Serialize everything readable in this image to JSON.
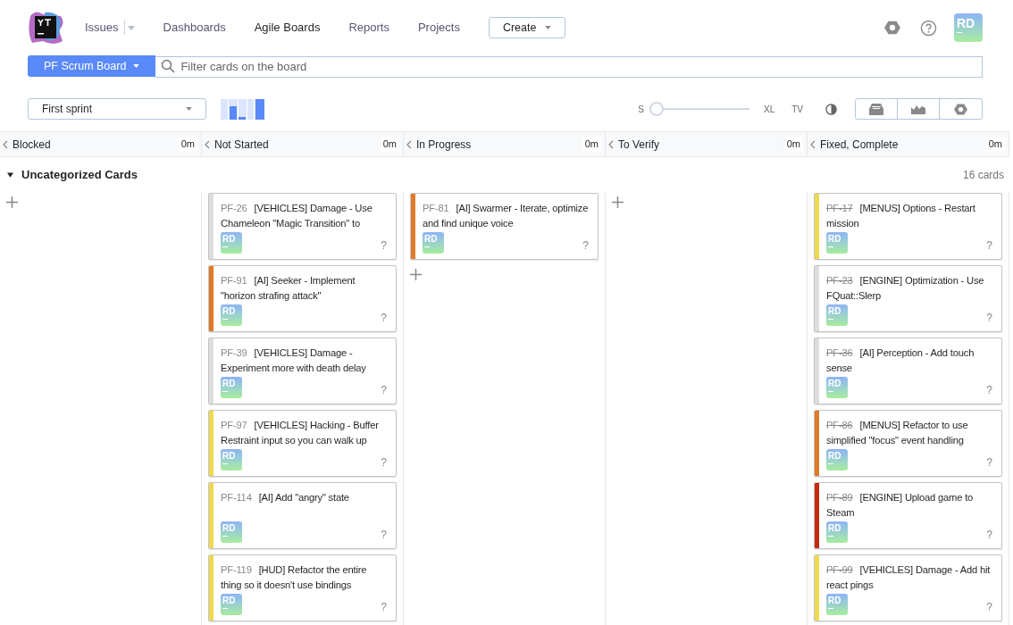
{
  "nav": [
    {
      "label": "Issues",
      "selected": false,
      "dropdown": true
    },
    {
      "label": "Dashboards",
      "selected": false,
      "dropdown": false
    },
    {
      "label": "Agile Boards",
      "selected": true,
      "dropdown": false
    },
    {
      "label": "Reports",
      "selected": false,
      "dropdown": false
    },
    {
      "label": "Projects",
      "selected": false,
      "dropdown": false
    }
  ],
  "create_button": "Create",
  "user": "RD",
  "board_button": "PF Scrum Board",
  "search": {
    "placeholder": "Filter cards on the board"
  },
  "sprint": "First sprint",
  "size": {
    "min": "S",
    "max": "XL",
    "tv": "TV",
    "level": 0
  },
  "columns": [
    {
      "name": "Blocked",
      "time": "0m"
    },
    {
      "name": "Not Started",
      "time": "0m",
      "cards": [
        {
          "id": "PF-26",
          "title": "[VEHICLES] Damage - Use Chameleon \"Magic Transition\" to",
          "color": "#dddddd",
          "resolved": false,
          "assignee": "RD",
          "estimate": "?"
        },
        {
          "id": "PF-91",
          "title": "[AI] Seeker - Implement \"horizon strafing attack\"",
          "color": "#e07b2a",
          "resolved": false,
          "assignee": "RD",
          "estimate": "?"
        },
        {
          "id": "PF-39",
          "title": "[VEHICLES] Damage - Experiment more with death delay",
          "color": "#dddddd",
          "resolved": false,
          "assignee": "RD",
          "estimate": "?"
        },
        {
          "id": "PF-97",
          "title": "[VEHICLES] Hacking - Buffer Restraint input so you can walk up",
          "color": "#eed94f",
          "resolved": false,
          "assignee": "RD",
          "estimate": "?"
        },
        {
          "id": "PF-114",
          "title": "[AI] Add \"angry\" state",
          "color": "#eed94f",
          "resolved": false,
          "assignee": "RD",
          "estimate": "?"
        },
        {
          "id": "PF-119",
          "title": "[HUD] Refactor the entire thing so it doesn't use bindings",
          "color": "#eed94f",
          "resolved": false,
          "assignee": "RD",
          "estimate": "?"
        }
      ]
    },
    {
      "name": "In Progress",
      "time": "0m",
      "cards": [
        {
          "id": "PF-81",
          "title": "[AI] Swarmer - Iterate, optimize and find unique voice",
          "color": "#e07b2a",
          "resolved": false,
          "assignee": "RD",
          "estimate": "?"
        }
      ]
    },
    {
      "name": "To Verify",
      "time": "0m"
    },
    {
      "name": "Fixed, Complete",
      "time": "0m",
      "cards": [
        {
          "id": "PF-17",
          "title": "[MENUS] Options - Restart mission",
          "color": "#eed94f",
          "resolved": true,
          "assignee": "RD",
          "estimate": "?"
        },
        {
          "id": "PF-23",
          "title": "[ENGINE] Optimization - Use FQuat::Slerp",
          "color": "#dddddd",
          "resolved": true,
          "assignee": "RD",
          "estimate": "?"
        },
        {
          "id": "PF-36",
          "title": "[AI] Perception - Add touch sense",
          "color": "#dddddd",
          "resolved": true,
          "assignee": "RD",
          "estimate": "?"
        },
        {
          "id": "PF-86",
          "title": "[MENUS] Refactor to use simplified \"focus\" event handling",
          "color": "#e07b2a",
          "resolved": true,
          "assignee": "RD",
          "estimate": "?"
        },
        {
          "id": "PF-89",
          "title": "[ENGINE] Upload game to Steam",
          "color": "#c4290e",
          "resolved": true,
          "assignee": "RD",
          "estimate": "?"
        },
        {
          "id": "PF-99",
          "title": "[VEHICLES] Damage - Add hit react pings",
          "color": "#eed94f",
          "resolved": true,
          "assignee": "RD",
          "estimate": "?"
        }
      ]
    }
  ],
  "swimlane": {
    "title": "Uncategorized Cards",
    "expanded": true,
    "count": "16 cards"
  }
}
